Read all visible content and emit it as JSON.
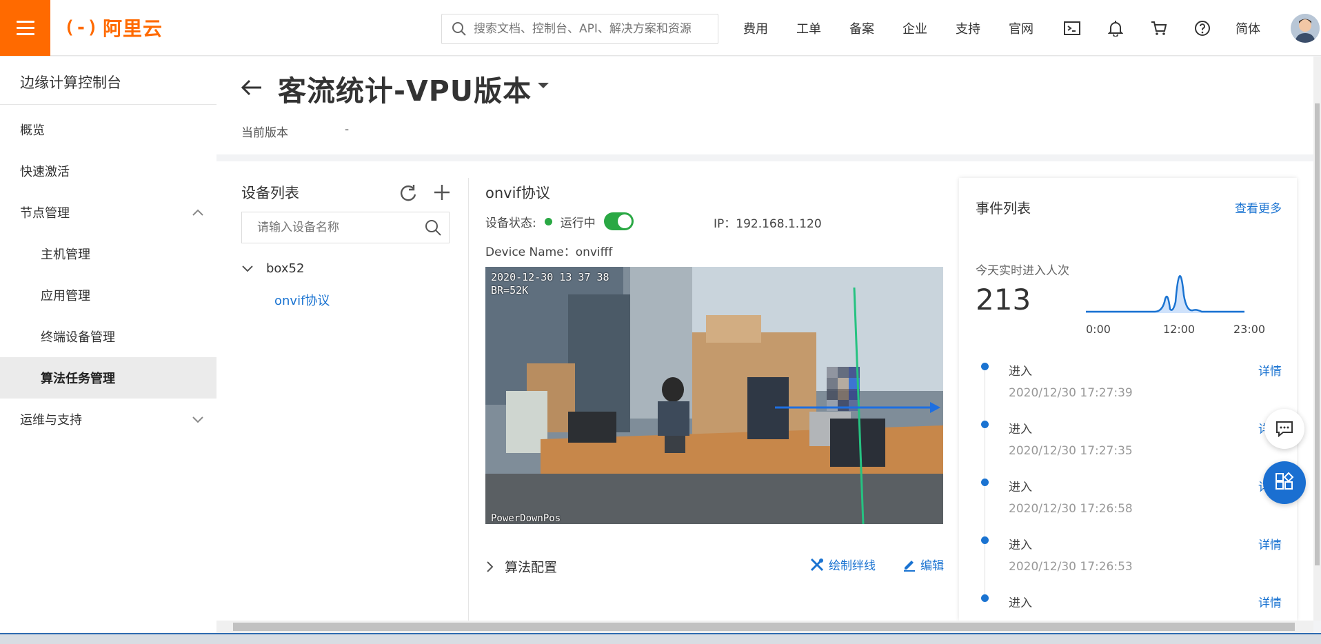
{
  "topbar": {
    "logo_text": "阿里云",
    "logo_mark": "(-)",
    "search_placeholder": "搜索文档、控制台、API、解决方案和资源",
    "nav": [
      "费用",
      "工单",
      "备案",
      "企业",
      "支持",
      "官网"
    ],
    "lang": "简体"
  },
  "sidebar": {
    "title": "边缘计算控制台",
    "items": [
      {
        "label": "概览"
      },
      {
        "label": "快速激活"
      },
      {
        "label": "节点管理"
      },
      {
        "label": "主机管理"
      },
      {
        "label": "应用管理"
      },
      {
        "label": "终端设备管理"
      },
      {
        "label": "算法任务管理"
      },
      {
        "label": "运维与支持"
      }
    ]
  },
  "header": {
    "title": "客流统计-VPU版本",
    "version_label": "当前版本",
    "version_value": "-"
  },
  "devices": {
    "title": "设备列表",
    "search_placeholder": "请输入设备名称",
    "node": "box52",
    "leaf": "onvif协议"
  },
  "detail": {
    "title": "onvif协议",
    "status_label": "设备状态:",
    "status_value": "运行中",
    "ip": "IP：192.168.1.120",
    "device_name": "Device Name：onvifff",
    "video_timestamp": "2020-12-30  13 37 38",
    "video_br": "BR=52K",
    "video_footer": "PowerDownPos",
    "algo_label": "算法配置",
    "draw_label": "绘制绊线",
    "edit_label": "编辑"
  },
  "events": {
    "title": "事件列表",
    "more": "查看更多",
    "today_label": "今天实时进入人次",
    "today_count": "213",
    "ticks": [
      "0:00",
      "12:00",
      "23:00"
    ],
    "items": [
      {
        "name": "进入",
        "time": "2020/12/30 17:27:39",
        "detail": "详情"
      },
      {
        "name": "进入",
        "time": "2020/12/30 17:27:35",
        "detail": "详情"
      },
      {
        "name": "进入",
        "time": "2020/12/30 17:26:58",
        "detail": "详情"
      },
      {
        "name": "进入",
        "time": "2020/12/30 17:26:53",
        "detail": "详情"
      },
      {
        "name": "进入",
        "time": "",
        "detail": "详情"
      }
    ]
  },
  "colors": {
    "brand": "#ff6a00",
    "link": "#1a73d1",
    "running": "#2aa844"
  }
}
